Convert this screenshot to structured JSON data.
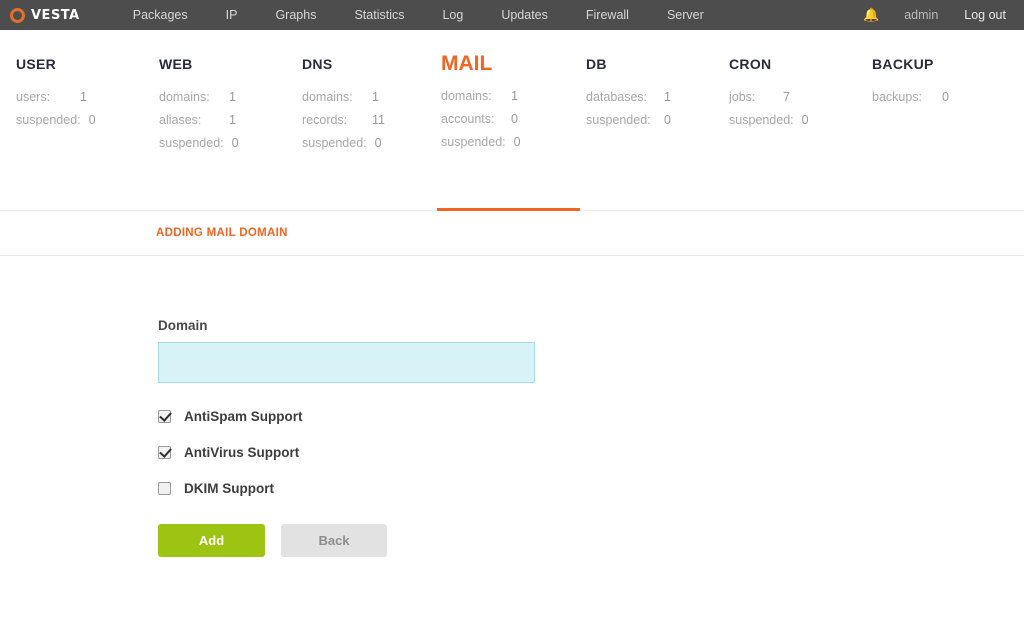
{
  "topbar": {
    "logo_text": "VESTA",
    "nav": [
      {
        "label": "Packages"
      },
      {
        "label": "IP"
      },
      {
        "label": "Graphs"
      },
      {
        "label": "Statistics"
      },
      {
        "label": "Log"
      },
      {
        "label": "Updates"
      },
      {
        "label": "Firewall"
      },
      {
        "label": "Server"
      }
    ],
    "bell_icon": "bell-icon",
    "user": "admin",
    "logout": "Log out",
    "background": "#4d4d4d"
  },
  "stats": [
    {
      "title": "USER",
      "active": false,
      "rows": [
        {
          "key": "users:",
          "value": "1"
        },
        {
          "key": "suspended:",
          "value": "0"
        }
      ]
    },
    {
      "title": "WEB",
      "active": false,
      "rows": [
        {
          "key": "domains:",
          "value": "1"
        },
        {
          "key": "aliases:",
          "value": "1"
        },
        {
          "key": "suspended:",
          "value": "0"
        }
      ]
    },
    {
      "title": "DNS",
      "active": false,
      "rows": [
        {
          "key": "domains:",
          "value": "1"
        },
        {
          "key": "records:",
          "value": "11"
        },
        {
          "key": "suspended:",
          "value": "0"
        }
      ]
    },
    {
      "title": "MAIL",
      "active": true,
      "rows": [
        {
          "key": "domains:",
          "value": "1"
        },
        {
          "key": "accounts:",
          "value": "0"
        },
        {
          "key": "suspended:",
          "value": "0"
        }
      ]
    },
    {
      "title": "DB",
      "active": false,
      "rows": [
        {
          "key": "databases:",
          "value": "1"
        },
        {
          "key": "suspended:",
          "value": "0"
        }
      ]
    },
    {
      "title": "CRON",
      "active": false,
      "rows": [
        {
          "key": "jobs:",
          "value": "7"
        },
        {
          "key": "suspended:",
          "value": "0"
        }
      ]
    },
    {
      "title": "BACKUP",
      "active": false,
      "rows": [
        {
          "key": "backups:",
          "value": "0"
        }
      ]
    }
  ],
  "toolbar": {
    "title": "ADDING MAIL DOMAIN"
  },
  "form": {
    "domain_label": "Domain",
    "domain_value": "",
    "domain_placeholder": "",
    "checkboxes": [
      {
        "label": "AntiSpam Support",
        "checked": true
      },
      {
        "label": "AntiVirus Support",
        "checked": true
      },
      {
        "label": "DKIM Support",
        "checked": false
      }
    ],
    "add_label": "Add",
    "back_label": "Back"
  },
  "colors": {
    "accent_orange": "#f26522",
    "button_green": "#9ec413",
    "header_gray": "#4d4d4d",
    "input_cyan": "#d7f3f7",
    "bell_green": "#c9d62b"
  }
}
